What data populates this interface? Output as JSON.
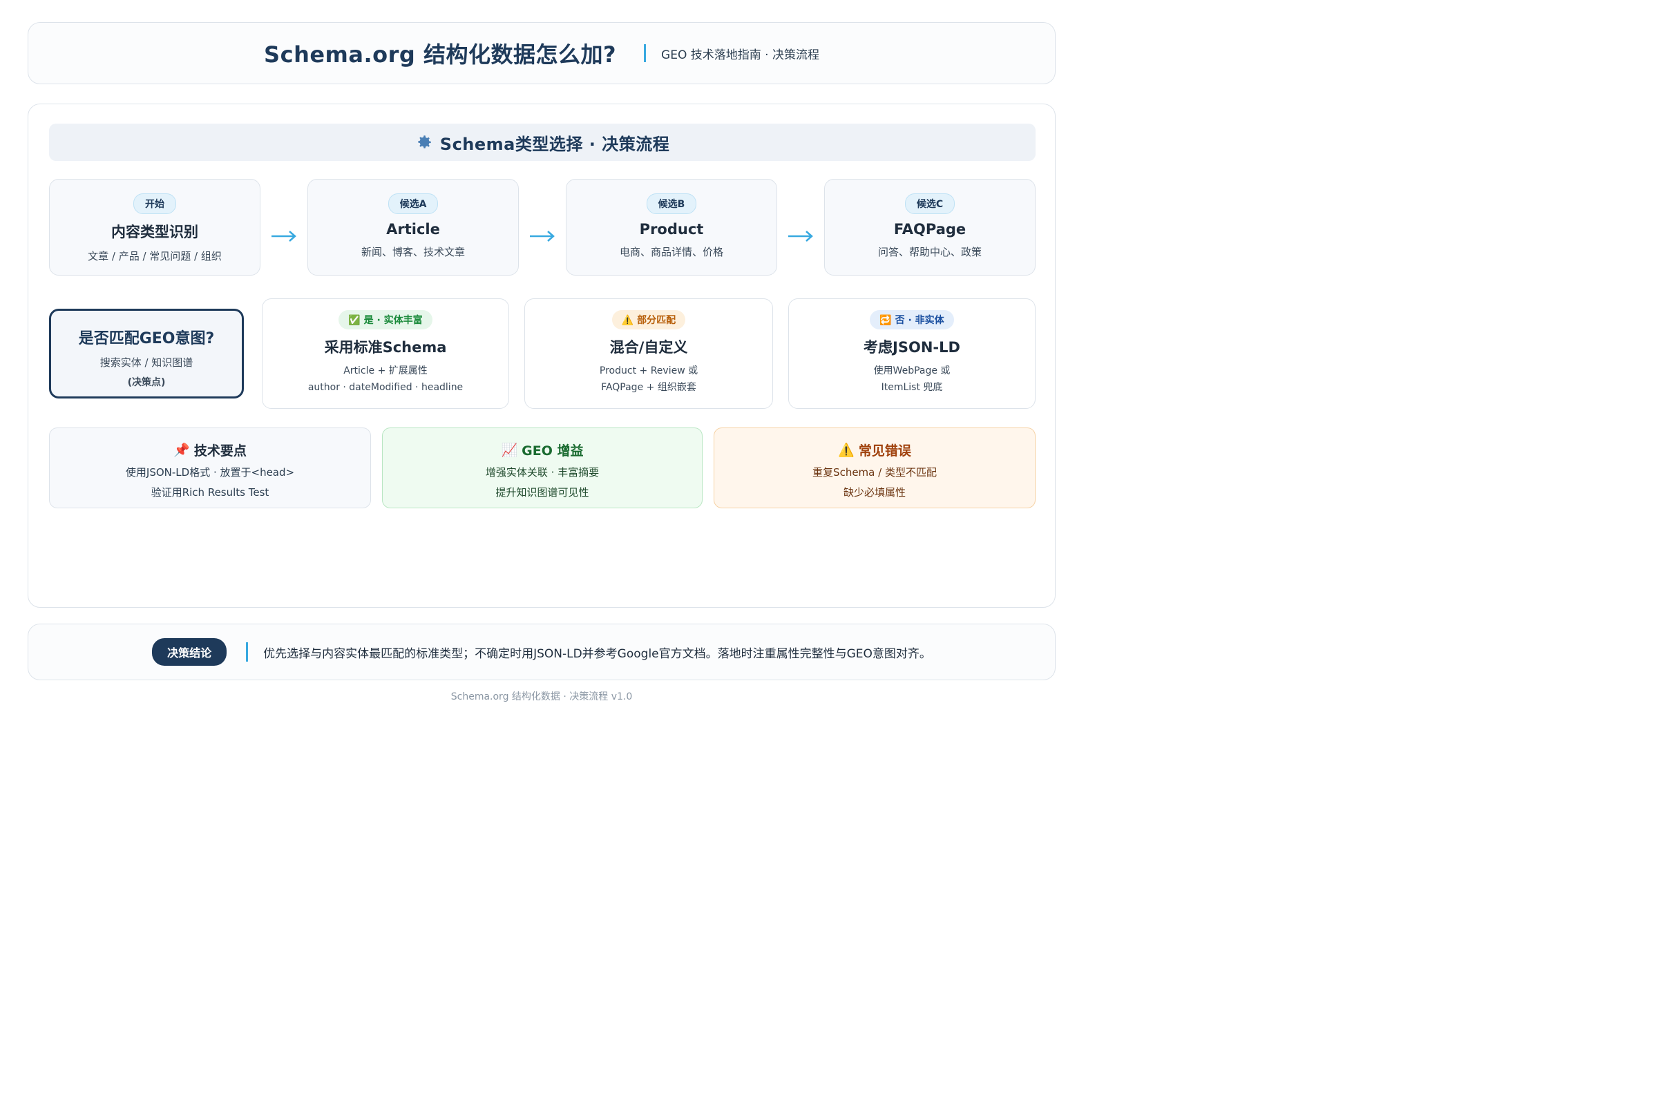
{
  "header": {
    "title": "Schema.org 结构化数据怎么加?",
    "subtitle": "GEO 技术落地指南 · 决策流程"
  },
  "banner": {
    "icon": "gear-icon",
    "text": "Schema类型选择 · 决策流程"
  },
  "flow": [
    {
      "tag": "开始",
      "title": "内容类型识别",
      "desc": "文章 / 产品 / 常见问题 / 组织"
    },
    {
      "tag": "候选A",
      "title": "Article",
      "desc": "新闻、博客、技术文章"
    },
    {
      "tag": "候选B",
      "title": "Product",
      "desc": "电商、商品详情、价格"
    },
    {
      "tag": "候选C",
      "title": "FAQPage",
      "desc": "问答、帮助中心、政策"
    }
  ],
  "decision": {
    "title": "是否匹配GEO意图?",
    "sub": "搜索实体 / 知识图谱",
    "note": "(决策点)"
  },
  "options": [
    {
      "tag": "✅ 是 · 实体丰富",
      "title": "采用标准Schema",
      "line1": "Article + 扩展属性",
      "line2": "author · dateModified · headline",
      "pill_bg": "#e6f6ea",
      "pill_color": "#1a8a3a"
    },
    {
      "tag": "⚠️ 部分匹配",
      "title": "混合/自定义",
      "line1": "Product + Review 或",
      "line2": "FAQPage + 组织嵌套",
      "pill_bg": "#fdf0dd",
      "pill_color": "#b8600b"
    },
    {
      "tag": "🔁 否 · 非实体",
      "title": "考虑JSON-LD",
      "line1": "使用WebPage 或",
      "line2": "ItemList 兜底",
      "pill_bg": "#e4eefb",
      "pill_color": "#1a4fa0"
    }
  ],
  "info": [
    {
      "icon": "📌",
      "title": "技术要点",
      "line1": "使用JSON-LD格式 · 放置于<head>",
      "line2": "验证用Rich Results Test",
      "bg": "#f7f9fc",
      "border": "#dde3ea",
      "title_color": "#1f2d3d",
      "text_color": "#2c3e50"
    },
    {
      "icon": "📈",
      "title": "GEO 增益",
      "line1": "增强实体关联 · 丰富摘要",
      "line2": "提升知识图谱可见性",
      "bg": "#effbf1",
      "border": "#b9e6c3",
      "title_color": "#1a6b30",
      "text_color": "#1f4a2c"
    },
    {
      "icon": "⚠️",
      "title": "常见错误",
      "line1": "重复Schema / 类型不匹配",
      "line2": "缺少必填属性",
      "bg": "#fff6ec",
      "border": "#f6d2a5",
      "title_color": "#a0410c",
      "text_color": "#6b3410"
    }
  ],
  "conclusion": {
    "badge": "决策结论",
    "text": "优先选择与内容实体最匹配的标准类型；不确定时用JSON-LD并参考Google官方文档。落地时注重属性完整性与GEO意图对齐。"
  },
  "footer": "Schema.org 结构化数据 · 决策流程 v1.0",
  "colors": {
    "accent": "#38a9e0",
    "navy": "#1e3a5a"
  }
}
